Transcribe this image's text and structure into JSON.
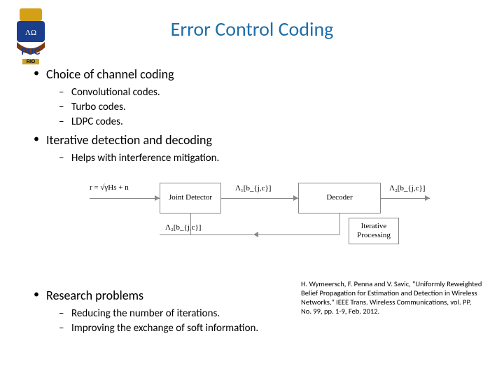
{
  "title": "Error Control Coding",
  "bullets": {
    "b1": {
      "text": "Choice of channel coding",
      "sub": [
        "Convolutional codes.",
        "Turbo codes.",
        "LDPC codes."
      ]
    },
    "b2": {
      "text": "Iterative detection and decoding",
      "sub": [
        "Helps  with interference mitigation."
      ]
    },
    "b3": {
      "text": "Research problems",
      "sub": [
        "Reducing the number of iterations.",
        "Improving the exchange of soft information."
      ]
    }
  },
  "diagram": {
    "input": "r = √γHs + n",
    "jd": "Joint Detector",
    "dec": "Decoder",
    "iter": "Iterative\nProcessing",
    "l1": "Λ₁[b_{j,c}]",
    "l2top": "Λ₂[b_{j,c}]",
    "l2bot": "Λ₂[b_{j,c}]"
  },
  "citation": "H. Wymeersch, F. Penna and V. Savic, \"Uniformly Reweighted Belief Propagation for Estimation and Detection in Wireless Networks,\" IEEE Trans. Wireless Communications, vol. PP, No. 99, pp. 1-9, Feb. 2012."
}
